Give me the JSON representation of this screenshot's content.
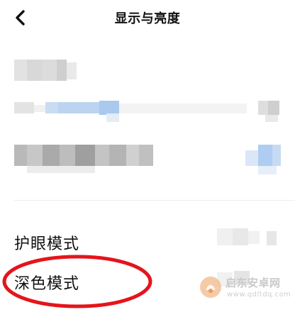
{
  "header": {
    "title": "显示与亮度",
    "back_icon": "chevron-left-icon"
  },
  "settings": {
    "eye_comfort_label": "护眼模式",
    "dark_mode_label": "深色模式"
  },
  "annotation": {
    "color": "#e4151b"
  },
  "watermark": {
    "name": "启东安卓网",
    "url": "www.qdltdq.com"
  }
}
